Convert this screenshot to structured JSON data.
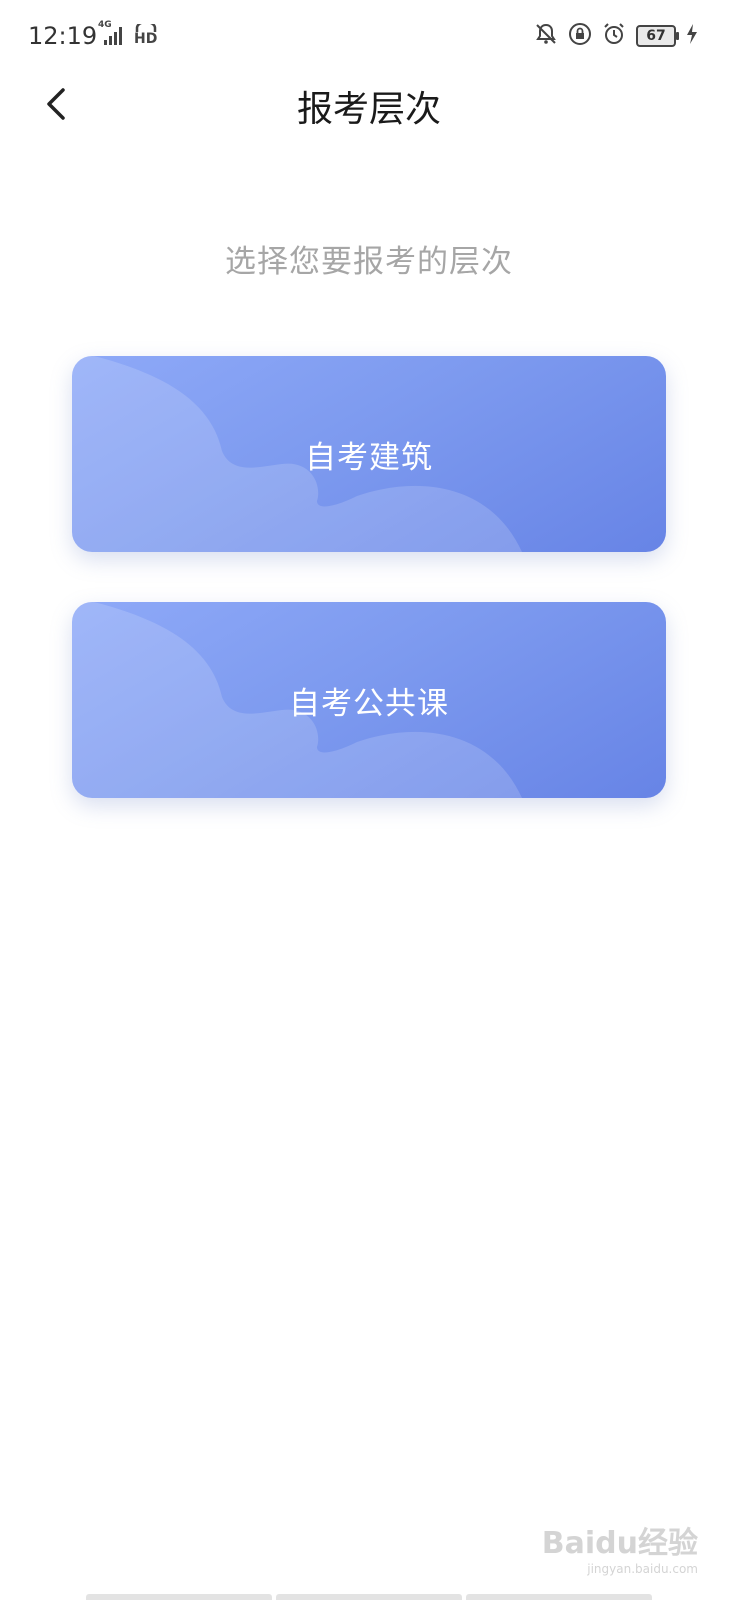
{
  "status_bar": {
    "time": "12:19",
    "network": "4G",
    "hd": "HD",
    "battery": "67"
  },
  "header": {
    "title": "报考层次"
  },
  "subtitle": "选择您要报考的层次",
  "options": [
    {
      "label": "自考建筑"
    },
    {
      "label": "自考公共课"
    }
  ],
  "watermark": {
    "brand": "Baidu经验",
    "url": "jingyan.baidu.com"
  }
}
